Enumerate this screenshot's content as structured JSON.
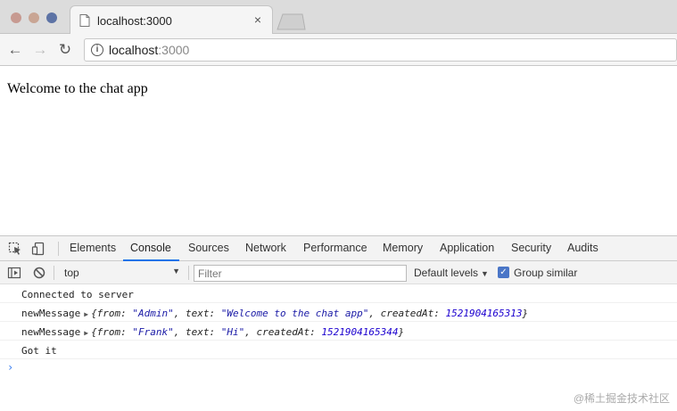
{
  "browser": {
    "tab_title": "localhost:3000",
    "tab_close": "×",
    "url_host": "localhost",
    "url_port": ":3000",
    "info_glyph": "i",
    "back_glyph": "←",
    "forward_glyph": "→",
    "reload_glyph": "↻"
  },
  "page": {
    "heading": "Welcome to the chat app"
  },
  "devtools": {
    "tabs": [
      "Elements",
      "Console",
      "Sources",
      "Network",
      "Performance",
      "Memory",
      "Application",
      "Security",
      "Audits"
    ],
    "active_tab": "Console",
    "console": {
      "context": "top",
      "filter_placeholder": "Filter",
      "levels": "Default levels",
      "group_similar": "Group similar",
      "logs": [
        {
          "text": "Connected to server"
        },
        {
          "label": "newMessage",
          "from": "Admin",
          "msg": "Welcome to the chat app",
          "createdAt": "1521904165313"
        },
        {
          "label": "newMessage",
          "from": "Frank",
          "msg": "Hi",
          "createdAt": "1521904165344"
        },
        {
          "text": "Got it"
        }
      ],
      "prompt": "›"
    }
  },
  "watermark": "@稀土掘金技术社区",
  "icons": [
    "favicon-icon",
    "info-icon",
    "inspect-icon",
    "device-icon",
    "sidebar-toggle-icon",
    "clear-console-icon",
    "checkbox-checked-icon"
  ]
}
